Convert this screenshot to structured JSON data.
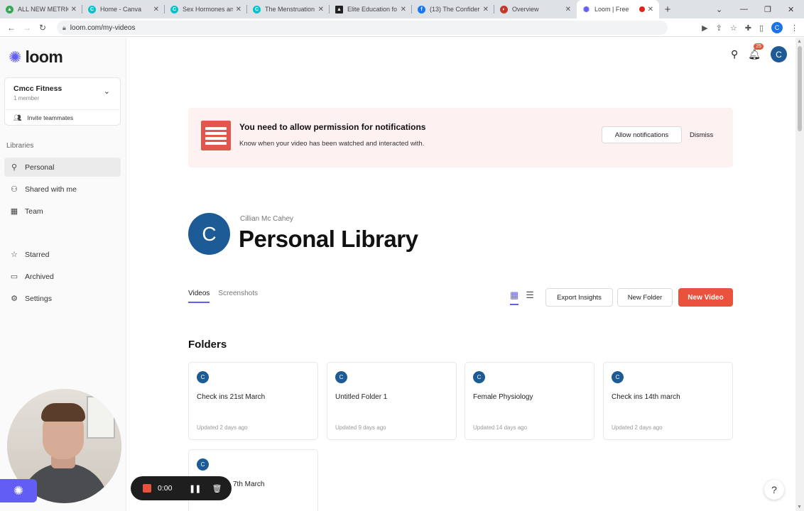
{
  "browser": {
    "tabs": [
      {
        "label": "ALL NEW METRIC",
        "color": "#34a853",
        "glyph": "▲"
      },
      {
        "label": "Home - Canva",
        "color": "#00c4cc",
        "glyph": "C"
      },
      {
        "label": "Sex Hormones an",
        "color": "#00c4cc",
        "glyph": "C"
      },
      {
        "label": "The Menstruation",
        "color": "#00c4cc",
        "glyph": "C"
      },
      {
        "label": "Elite Education fo",
        "color": "#222222",
        "glyph": "▲"
      },
      {
        "label": "(13) The Confider",
        "color": "#1877f2",
        "glyph": "f"
      },
      {
        "label": "Overview",
        "color": "#c0392b",
        "glyph": "◐"
      },
      {
        "label": "Loom | Free",
        "color": "#625df5",
        "glyph": "✺"
      }
    ],
    "new_tab": "+",
    "url": "loom.com/my-videos",
    "profile_initial": "C"
  },
  "sidebar": {
    "logo_text": "loom",
    "workspace": {
      "name": "Cmcc Fitness",
      "members": "1 member",
      "invite_label": "Invite teammates"
    },
    "libraries_title": "Libraries",
    "items": [
      {
        "label": "Personal",
        "icon": "person-icon"
      },
      {
        "label": "Shared with me",
        "icon": "people-icon"
      },
      {
        "label": "Team",
        "icon": "building-icon"
      },
      {
        "label": "Starred",
        "icon": "star-icon"
      },
      {
        "label": "Archived",
        "icon": "archive-icon"
      },
      {
        "label": "Settings",
        "icon": "gear-icon"
      }
    ]
  },
  "header": {
    "notification_count": "25",
    "avatar_initial": "C"
  },
  "notification": {
    "title": "You need to allow permission for notifications",
    "subtitle": "Know when your video has been watched and interacted with.",
    "allow_label": "Allow notifications",
    "dismiss_label": "Dismiss"
  },
  "library": {
    "avatar_initial": "C",
    "owner": "Cillian Mc Cahey",
    "title": "Personal Library",
    "tabs": [
      "Videos",
      "Screenshots"
    ],
    "export_label": "Export Insights",
    "new_folder_label": "New Folder",
    "new_video_label": "New Video"
  },
  "folders": {
    "title": "Folders",
    "items": [
      {
        "initial": "C",
        "name": "Check ins 21st March",
        "updated": "Updated 2 days ago"
      },
      {
        "initial": "C",
        "name": "Untitled Folder 1",
        "updated": "Updated 9 days ago"
      },
      {
        "initial": "C",
        "name": "Female Physiology",
        "updated": "Updated 14 days ago"
      },
      {
        "initial": "C",
        "name": "Check ins 14th march",
        "updated": "Updated 2 days ago"
      },
      {
        "initial": "C",
        "name": "7th March",
        "updated": ""
      }
    ]
  },
  "recorder": {
    "time": "0:00"
  },
  "help": "?",
  "colors": {
    "brand": "#625df5",
    "accent_red": "#e9523c",
    "avatar_blue": "#1c5b95"
  }
}
